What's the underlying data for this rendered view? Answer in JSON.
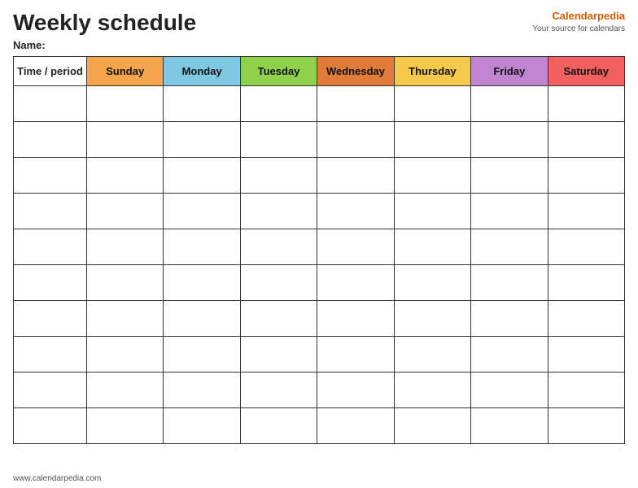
{
  "title": "Weekly schedule",
  "brand": {
    "name_part1": "Calendar",
    "name_part2": "pedia",
    "tagline": "Your source for calendars"
  },
  "name_label": "Name:",
  "columns": {
    "time": "Time / period",
    "sunday": "Sunday",
    "monday": "Monday",
    "tuesday": "Tuesday",
    "wednesday": "Wednesday",
    "thursday": "Thursday",
    "friday": "Friday",
    "saturday": "Saturday"
  },
  "rows": 10,
  "footer": "www.calendarpedia.com"
}
